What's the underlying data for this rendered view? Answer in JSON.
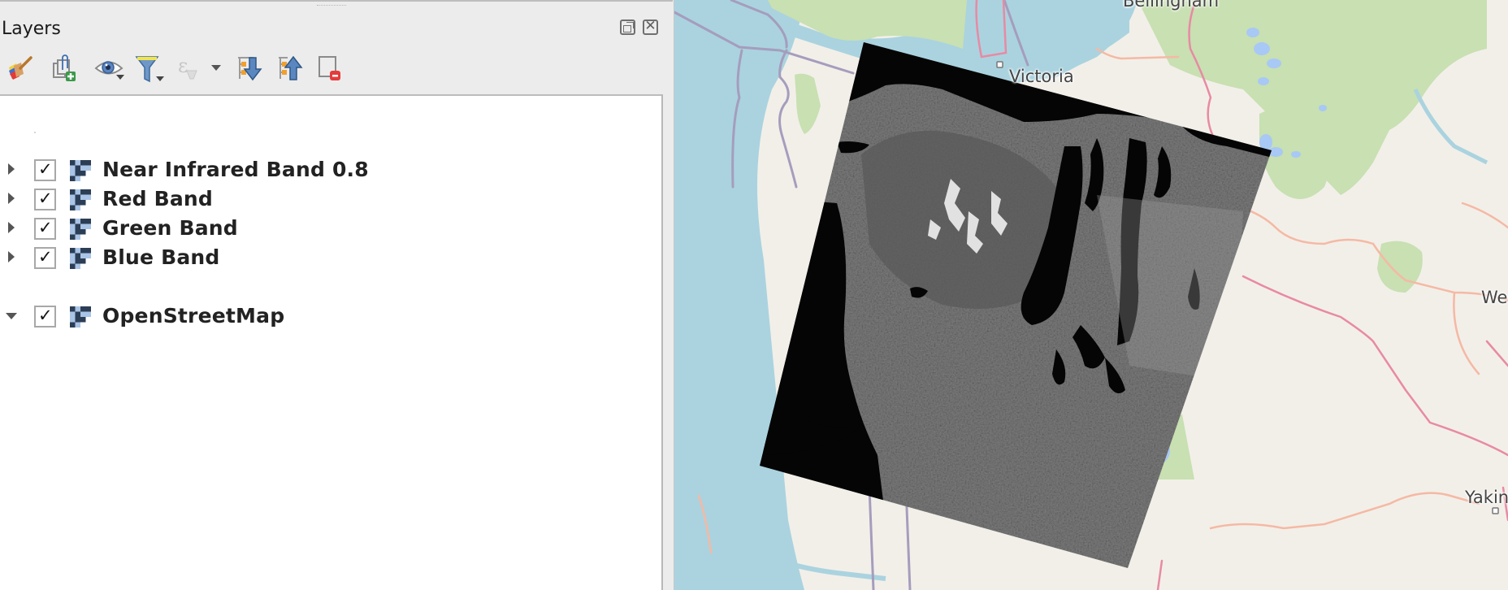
{
  "dock": {
    "title": "Layers",
    "float_button": "float-dock",
    "close_button": "close-dock",
    "toolbar": [
      {
        "name": "style-manager",
        "icon": "paintbrush-icon",
        "tooltip": "Open Layer Styling Panel"
      },
      {
        "name": "add-group",
        "icon": "add-group-icon",
        "tooltip": "Add Group"
      },
      {
        "name": "manage-visibility",
        "icon": "eye-icon",
        "tooltip": "Manage Map Themes"
      },
      {
        "name": "filter-legend",
        "icon": "filter-icon",
        "tooltip": "Filter Legend"
      },
      {
        "name": "filter-by-expression",
        "icon": "expression-filter-icon",
        "tooltip": "Filter Legend by Expression",
        "disabled": true
      },
      {
        "name": "expand-all",
        "icon": "expand-all-icon",
        "tooltip": "Expand All"
      },
      {
        "name": "collapse-all",
        "icon": "collapse-all-icon",
        "tooltip": "Collapse All"
      },
      {
        "name": "remove-layer",
        "icon": "remove-layer-icon",
        "tooltip": "Remove Layer/Group"
      }
    ],
    "layers": [
      {
        "name": "Near Infrared Band 0.8",
        "checked": true,
        "expanded": false,
        "type": "raster"
      },
      {
        "name": "Red Band",
        "checked": true,
        "expanded": false,
        "type": "raster"
      },
      {
        "name": "Green Band",
        "checked": true,
        "expanded": false,
        "type": "raster"
      },
      {
        "name": "Blue Band",
        "checked": true,
        "expanded": false,
        "type": "raster"
      },
      {
        "name": "OpenStreetMap",
        "checked": true,
        "expanded": true,
        "type": "raster"
      }
    ],
    "check_glyph": "✓",
    "close_glyph": "✕"
  },
  "map": {
    "labels": {
      "bellingham": "Bellingham",
      "victoria": "Victoria",
      "wenatchee": "We",
      "yakima": "Yakin"
    },
    "colors": {
      "water": "#aad3df",
      "land": "#f2efe9",
      "forest": "#c8e0b2",
      "lake": "#a8c8f5",
      "boundary": "#a59dbd",
      "highway": "#e88aa3",
      "road": "#f5b9a4",
      "raster_black": "#000000"
    }
  }
}
